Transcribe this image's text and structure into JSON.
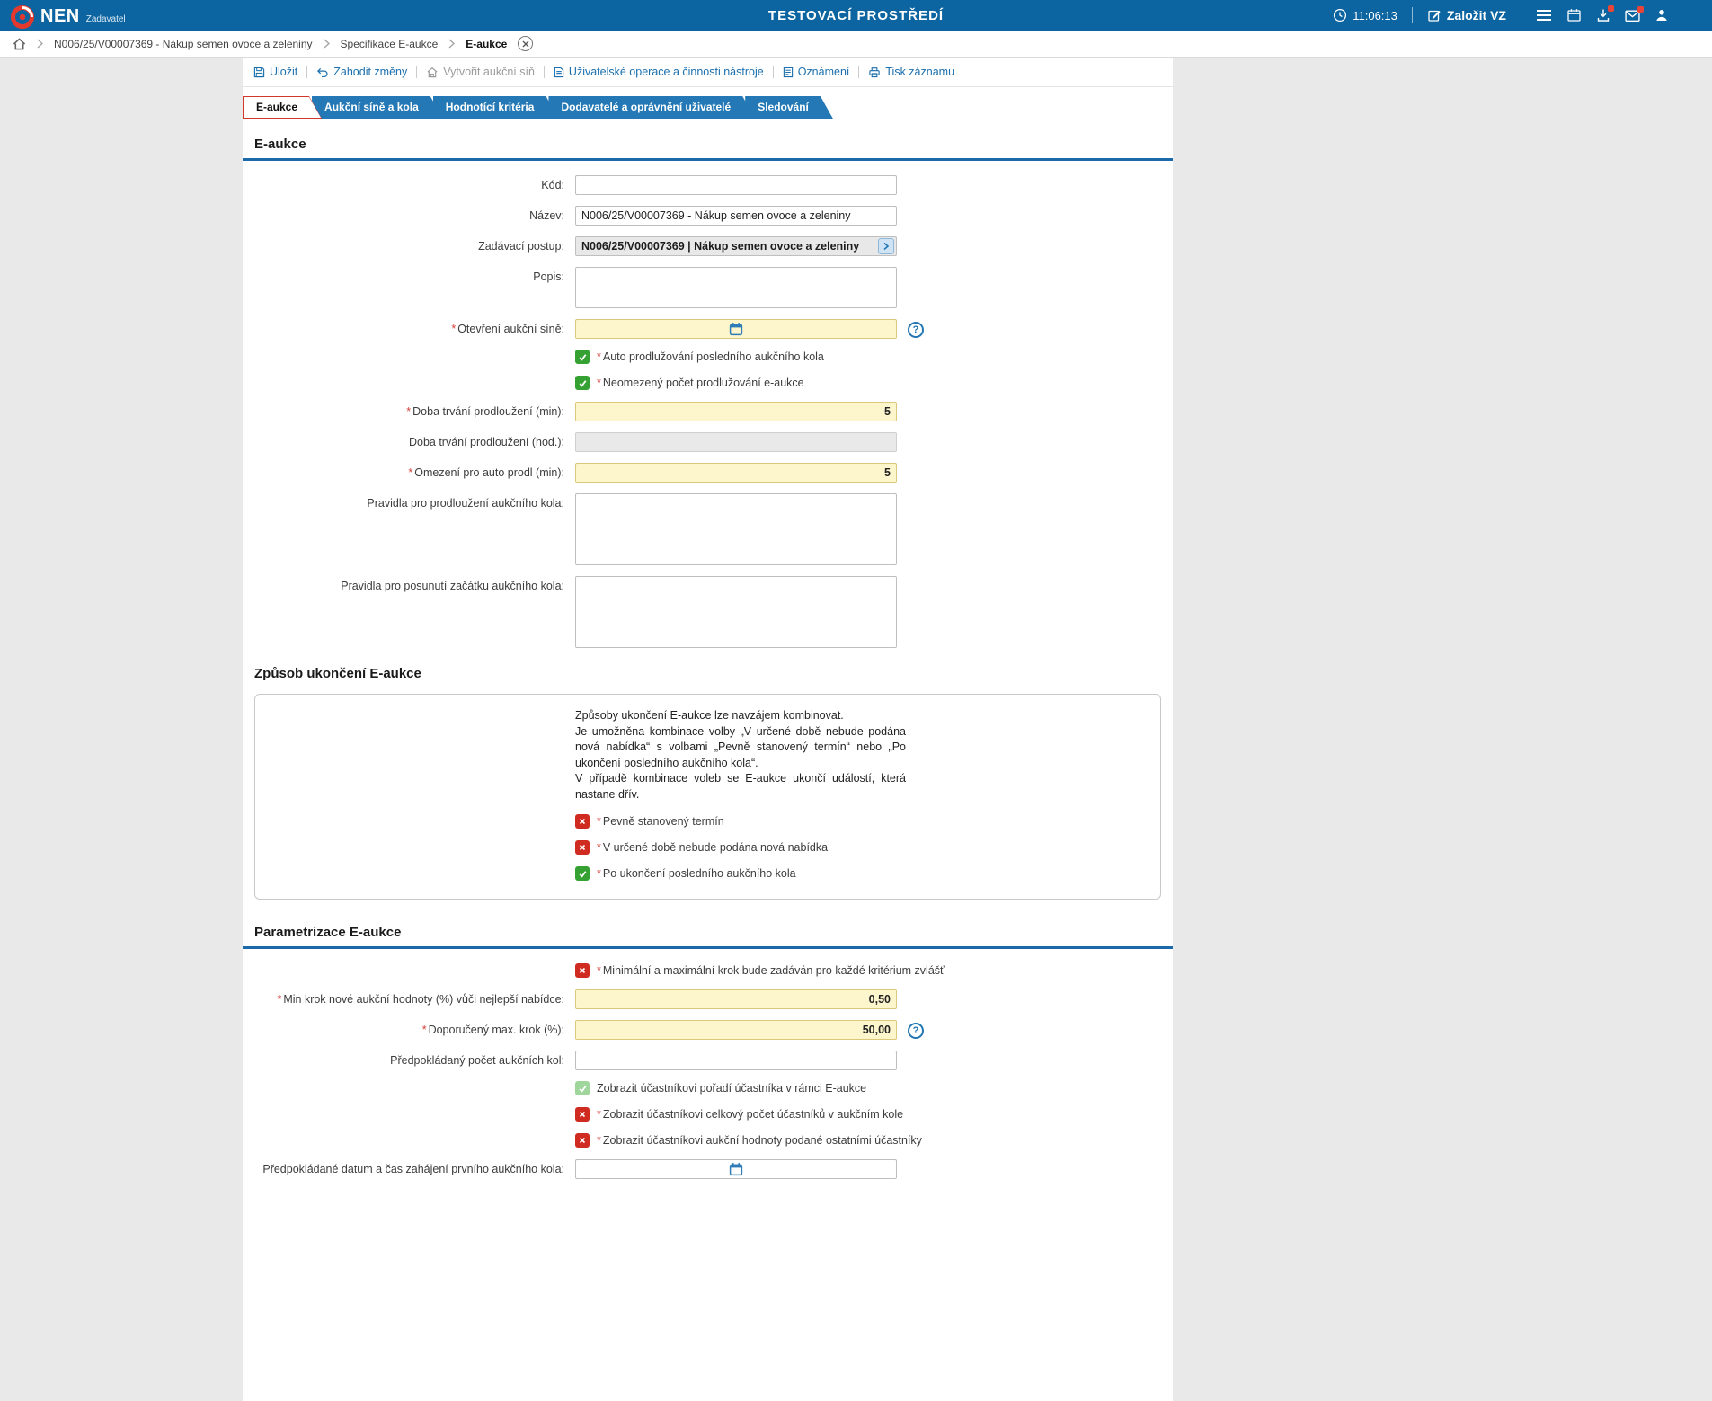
{
  "header": {
    "brand": "NEN",
    "brand_subtitle": "Zadavatel",
    "environment_title": "TESTOVACÍ PROSTŘEDÍ",
    "time": "11:06:13",
    "create_vz_label": "Založit VZ"
  },
  "breadcrumb": {
    "items": [
      "N006/25/V00007369 - Nákup semen ovoce a zeleniny",
      "Specifikace E-aukce",
      "E-aukce"
    ]
  },
  "toolbar": {
    "items": [
      {
        "label": "Uložit",
        "state": "enabled"
      },
      {
        "label": "Zahodit změny",
        "state": "enabled"
      },
      {
        "label": "Vytvořit aukční síň",
        "state": "disabled"
      },
      {
        "label": "Uživatelské operace a činnosti nástroje",
        "state": "enabled"
      },
      {
        "label": "Oznámení",
        "state": "enabled"
      },
      {
        "label": "Tisk záznamu",
        "state": "enabled"
      }
    ]
  },
  "tabs": [
    {
      "label": "E-aukce",
      "active": true
    },
    {
      "label": "Aukční síně a kola",
      "active": false
    },
    {
      "label": "Hodnotící kritéria",
      "active": false
    },
    {
      "label": "Dodavatelé a oprávnění uživatelé",
      "active": false
    },
    {
      "label": "Sledování",
      "active": false
    }
  ],
  "sections": {
    "eaukce": {
      "title": "E-aukce"
    },
    "zpusob": {
      "title": "Způsob ukončení E-aukce"
    },
    "parametrizace": {
      "title": "Parametrizace E-aukce"
    }
  },
  "form": {
    "kod": {
      "label": "Kód:",
      "value": ""
    },
    "nazev": {
      "label": "Název:",
      "value": "N006/25/V00007369 - Nákup semen ovoce a zeleniny"
    },
    "zadavaci_postup": {
      "label": "Zadávací postup:",
      "value": "N006/25/V00007369 | Nákup semen ovoce a zeleniny"
    },
    "popis": {
      "label": "Popis:",
      "value": ""
    },
    "otevreni_sine": {
      "label": "Otevření aukční síně:",
      "required": "*",
      "value": ""
    },
    "auto_prodluzovani": {
      "label": "Auto prodlužování posledního aukčního kola",
      "required": "*",
      "state": "checked"
    },
    "neomezeny_pocet": {
      "label": "Neomezený počet prodlužování e-aukce",
      "required": "*",
      "state": "checked"
    },
    "doba_trvani_min": {
      "label": "Doba trvání prodloužení (min):",
      "required": "*",
      "value": "5"
    },
    "doba_trvani_hod": {
      "label": "Doba trvání prodloužení (hod.):",
      "value": "",
      "state": "disabled"
    },
    "omezeni_auto_prodl": {
      "label": "Omezení pro auto prodl (min):",
      "required": "*",
      "value": "5"
    },
    "pravidla_prodlouzeni": {
      "label": "Pravidla pro prodloužení aukčního kola:",
      "value": ""
    },
    "pravidla_posunuti": {
      "label": "Pravidla pro posunutí začátku aukčního kola:",
      "value": ""
    }
  },
  "zpusob_ukonceni": {
    "info_lines": [
      "Způsoby ukončení E-aukce lze navzájem kombinovat.",
      "Je umožněna kombinace volby „V určené době nebude podána nová nabídka“ s volbami „Pevně stanovený termín“ nebo „Po ukončení posledního aukčního kola“.",
      "V případě kombinace voleb se E-aukce ukončí událostí, která nastane dřív."
    ],
    "options": [
      {
        "label": "Pevně stanovený termín",
        "required": "*",
        "state": "crossed"
      },
      {
        "label": "V určené době nebude podána nová nabídka",
        "required": "*",
        "state": "crossed"
      },
      {
        "label": "Po ukončení posledního aukčního kola",
        "required": "*",
        "state": "checked"
      }
    ]
  },
  "parametrizace": {
    "min_max_krok": {
      "label": "Minimální a maximální krok bude zadáván pro každé kritérium zvlášť",
      "required": "*",
      "state": "crossed"
    },
    "min_krok": {
      "label": "Min krok nové aukční hodnoty (%) vůči nejlepší nabídce:",
      "required": "*",
      "value": "0,50"
    },
    "doporuceny_max_krok": {
      "label": "Doporučený max. krok (%):",
      "required": "*",
      "value": "50,00"
    },
    "pocet_kol": {
      "label": "Předpokládaný počet aukčních kol:",
      "value": ""
    },
    "zobrazit_poradi": {
      "label": "Zobrazit účastníkovi pořadí účastníka v rámci E-aukce",
      "state": "checked-disabled"
    },
    "zobrazit_pocet": {
      "label": "Zobrazit účastníkovi celkový počet účastníků v aukčním kole",
      "required": "*",
      "state": "crossed"
    },
    "zobrazit_hodnoty": {
      "label": "Zobrazit účastníkovi aukční hodnoty podané ostatními účastníky",
      "required": "*",
      "state": "crossed"
    },
    "datum_zahajeni": {
      "label": "Předpokládané datum a čas zahájení prvního aukčního kola:",
      "value": ""
    }
  },
  "icons": {
    "help": "?"
  },
  "colors": {
    "header_bg": "#0c65a0",
    "brand_red": "#e6392d",
    "tab_blue": "#2478b5",
    "tab_active_border": "#d2372a",
    "section_underline": "#1b69a9",
    "link_blue": "#1b6fae",
    "required_field_bg": "#fdf6cd",
    "checkbox_green": "#35a133",
    "checkbox_red": "#cf2b21",
    "checkbox_green_disabled": "#9ed69b",
    "notification_badge": "#e8443a"
  }
}
